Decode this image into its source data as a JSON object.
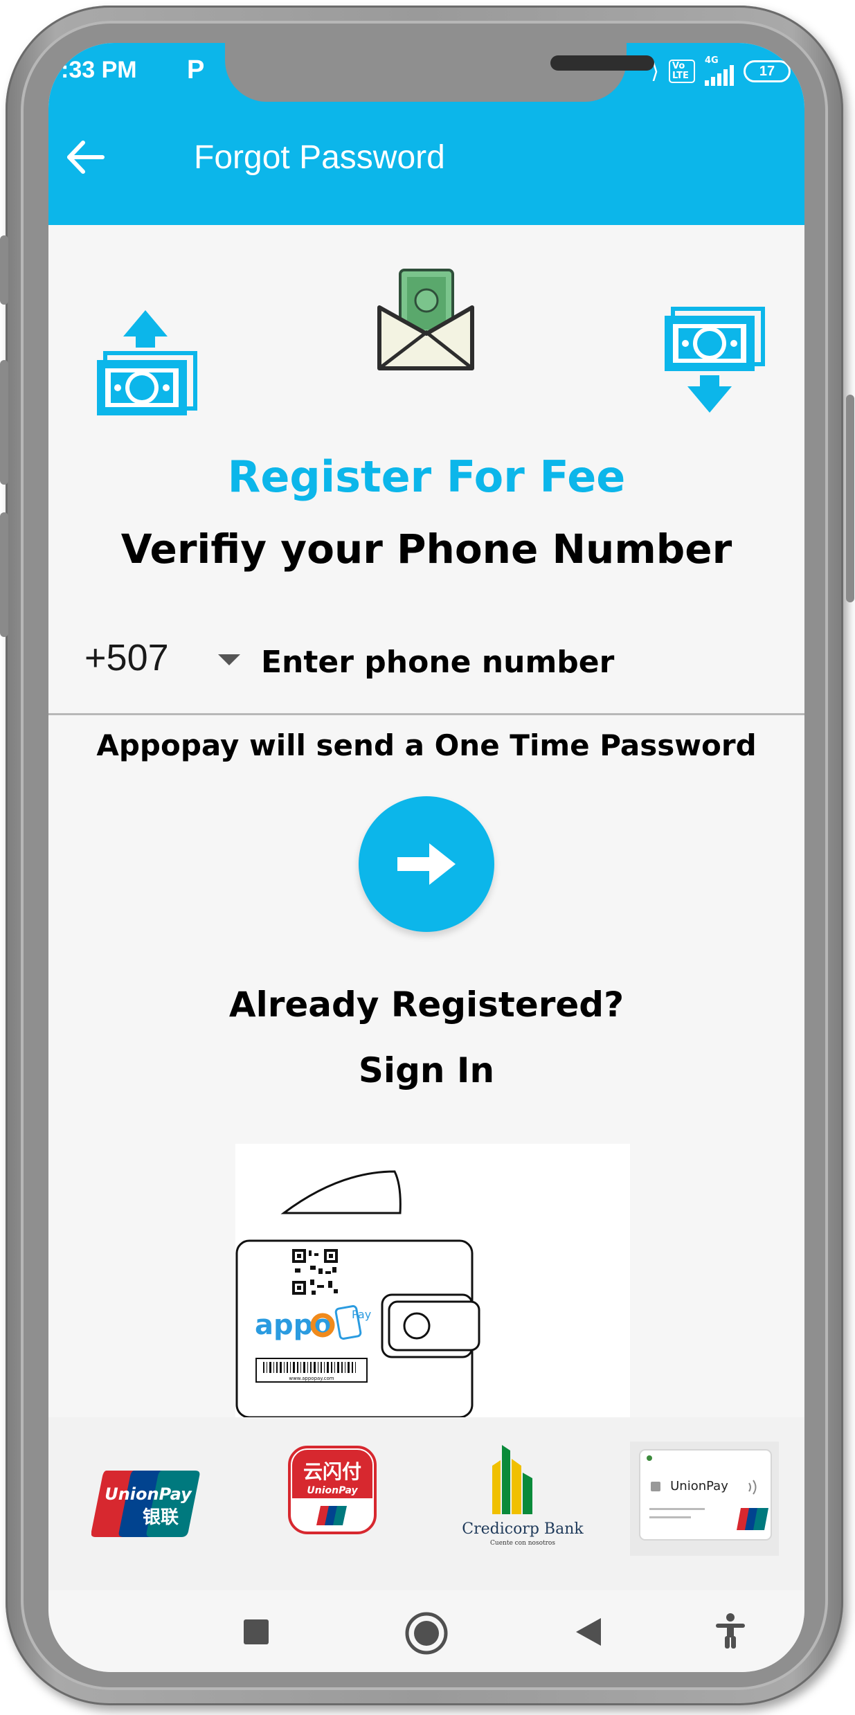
{
  "status_bar": {
    "time": ":33 PM",
    "p_icon": "P",
    "volte": "Vo LTE",
    "network": "4G",
    "battery": "17"
  },
  "appbar": {
    "back_icon": "arrow-left-icon",
    "title": "Forgot Password"
  },
  "icons": {
    "left": "money-send-icon",
    "center": "money-envelope-icon",
    "right": "money-receive-icon"
  },
  "main": {
    "heading": "Register For Fee",
    "subheading": "Verifiy your Phone Number",
    "country_code": "+507",
    "phone_placeholder": "Enter phone number",
    "otp_notice": "Appopay will send a One Time Password",
    "already_registered": "Already Registered?",
    "sign_in": "Sign In"
  },
  "wallet": {
    "brand_appo": "appo",
    "brand_pay": "Pay",
    "barcode_caption": "www.appopay.com"
  },
  "partners": [
    {
      "name": "UnionPay",
      "sub": "银联"
    },
    {
      "name": "云闪付",
      "sub": "UnionPay"
    },
    {
      "name": "Credicorp Bank",
      "sub": "Cuente con nosotros"
    },
    {
      "name": "UnionPay",
      "sub": "card"
    }
  ],
  "colors": {
    "accent": "#0cb6ea",
    "unionpay_red": "#d7282f",
    "unionpay_blue": "#01438f",
    "unionpay_green": "#00797e"
  }
}
